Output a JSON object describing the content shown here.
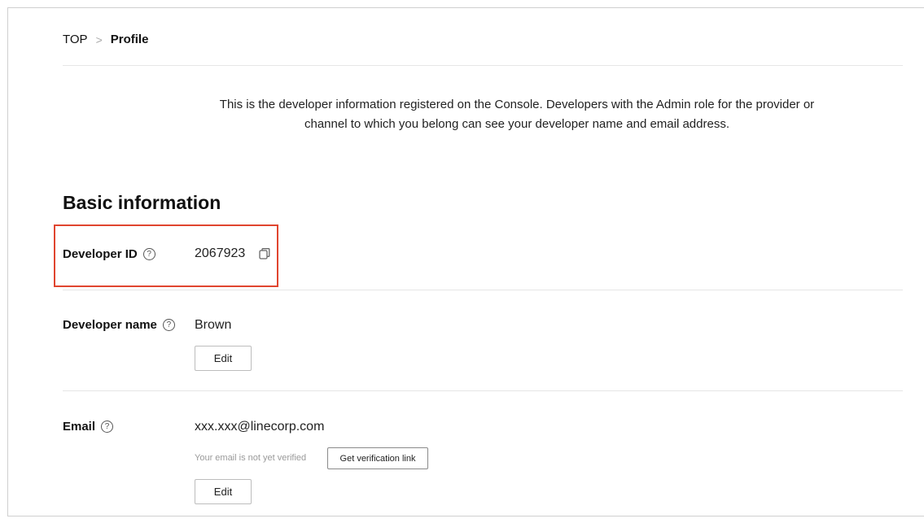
{
  "breadcrumb": {
    "root": "TOP",
    "separator": ">",
    "current": "Profile"
  },
  "intro": {
    "line1": "This is the developer information registered on the Console. Developers with the Admin role for the provider or",
    "line2": "channel to which you belong can see your developer name and email address."
  },
  "section": {
    "title": "Basic information"
  },
  "fields": {
    "developer_id": {
      "label": "Developer ID",
      "value": "2067923",
      "help": "?"
    },
    "developer_name": {
      "label": "Developer name",
      "value": "Brown",
      "help": "?",
      "edit_label": "Edit"
    },
    "email": {
      "label": "Email",
      "value": "xxx.xxx@linecorp.com",
      "help": "?",
      "not_verified": "Your email is not yet verified",
      "verify_label": "Get verification link",
      "edit_label": "Edit"
    }
  },
  "colors": {
    "highlight_border": "#e0452f"
  }
}
